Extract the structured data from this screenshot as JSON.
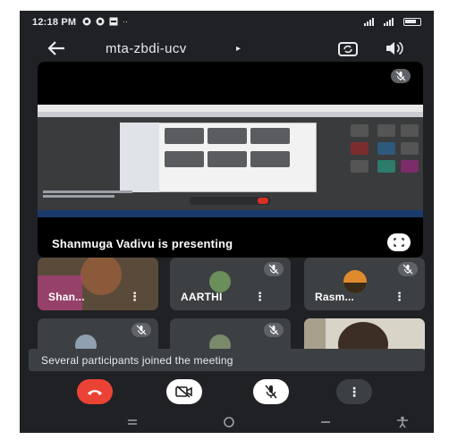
{
  "status_bar": {
    "time": "12:18 PM"
  },
  "app_bar": {
    "meeting_code": "mta-zbdi-ucv",
    "caret": "▸"
  },
  "main_tile": {
    "presenting_label": "Shanmuga Vadivu is presenting"
  },
  "participants": [
    {
      "name": "Shan...",
      "kind": "video"
    },
    {
      "name": "AARTHI",
      "kind": "avatar"
    },
    {
      "name": "Rasm...",
      "kind": "avatar"
    },
    {
      "name": "",
      "kind": "avatar"
    },
    {
      "name": "",
      "kind": "avatar"
    },
    {
      "name": "",
      "kind": "video"
    }
  ],
  "toast": {
    "message": "Several participants joined the meeting"
  },
  "controls": {
    "menu_label": "⋮"
  },
  "colors": {
    "background": "#202124",
    "tile": "#3c4043",
    "end_call": "#ea4335"
  },
  "icons": [
    "back-arrow-icon",
    "switch-camera-icon",
    "speaker-icon",
    "mic-off-icon",
    "fullscreen-icon",
    "end-call-icon",
    "video-off-icon",
    "more-vert-icon"
  ]
}
